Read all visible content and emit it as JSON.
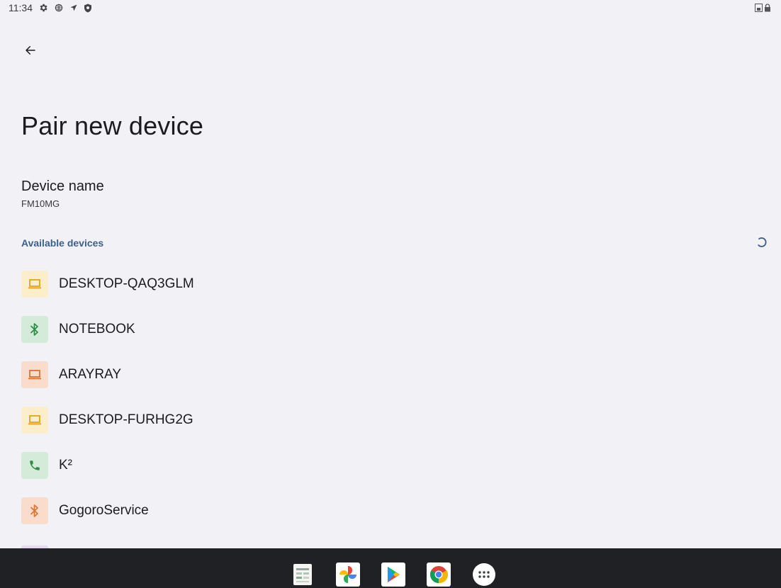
{
  "status_bar": {
    "time": "11:34",
    "left_icons": [
      "settings-icon",
      "vpn-globe-icon",
      "location-arrow-icon",
      "shield-icon"
    ],
    "right_icons": [
      "sim-icon",
      "lock-icon"
    ]
  },
  "header": {
    "back_icon": "arrow-back-icon",
    "title": "Pair new device"
  },
  "device_name": {
    "title": "Device name",
    "value": "FM10MG"
  },
  "available_devices": {
    "header": "Available devices",
    "scanning_icon": "progress-spinner-icon",
    "items": [
      {
        "label": "DESKTOP-QAQ3GLM",
        "icon": "laptop-icon",
        "icon_bg": "#fdeecb",
        "icon_color": "#e3a21a"
      },
      {
        "label": "NOTEBOOK",
        "icon": "bluetooth-icon",
        "icon_bg": "#d4ebd9",
        "icon_color": "#2f8a47"
      },
      {
        "label": "ARAYRAY",
        "icon": "laptop-icon",
        "icon_bg": "#f9dccb",
        "icon_color": "#d97535"
      },
      {
        "label": "DESKTOP-FURHG2G",
        "icon": "laptop-icon",
        "icon_bg": "#fdeecb",
        "icon_color": "#e3a21a"
      },
      {
        "label": "K²",
        "icon": "phone-icon",
        "icon_bg": "#d4ebd9",
        "icon_color": "#2f8a47"
      },
      {
        "label": "GogoroService",
        "icon": "bluetooth-icon",
        "icon_bg": "#f9dccb",
        "icon_color": "#d97535"
      }
    ]
  },
  "taskbar": {
    "apps": [
      "sheets-app-icon",
      "photos-app-icon",
      "play-store-app-icon",
      "chrome-app-icon",
      "app-launcher-icon"
    ]
  },
  "colors": {
    "background": "#f1f1f6",
    "accent": "#3e5f8a",
    "taskbar": "#202124"
  }
}
